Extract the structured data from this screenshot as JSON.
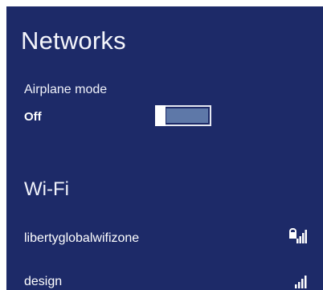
{
  "panel": {
    "title": "Networks",
    "background": "#1d2a68"
  },
  "airplane_mode": {
    "label": "Airplane mode",
    "state_text": "Off",
    "on": false
  },
  "wifi": {
    "section_title": "Wi-Fi",
    "networks": [
      {
        "name": "libertyglobalwifizone",
        "icon": "wifi-signal-secured-icon"
      },
      {
        "name": "design",
        "icon": "wifi-signal-icon"
      }
    ]
  }
}
